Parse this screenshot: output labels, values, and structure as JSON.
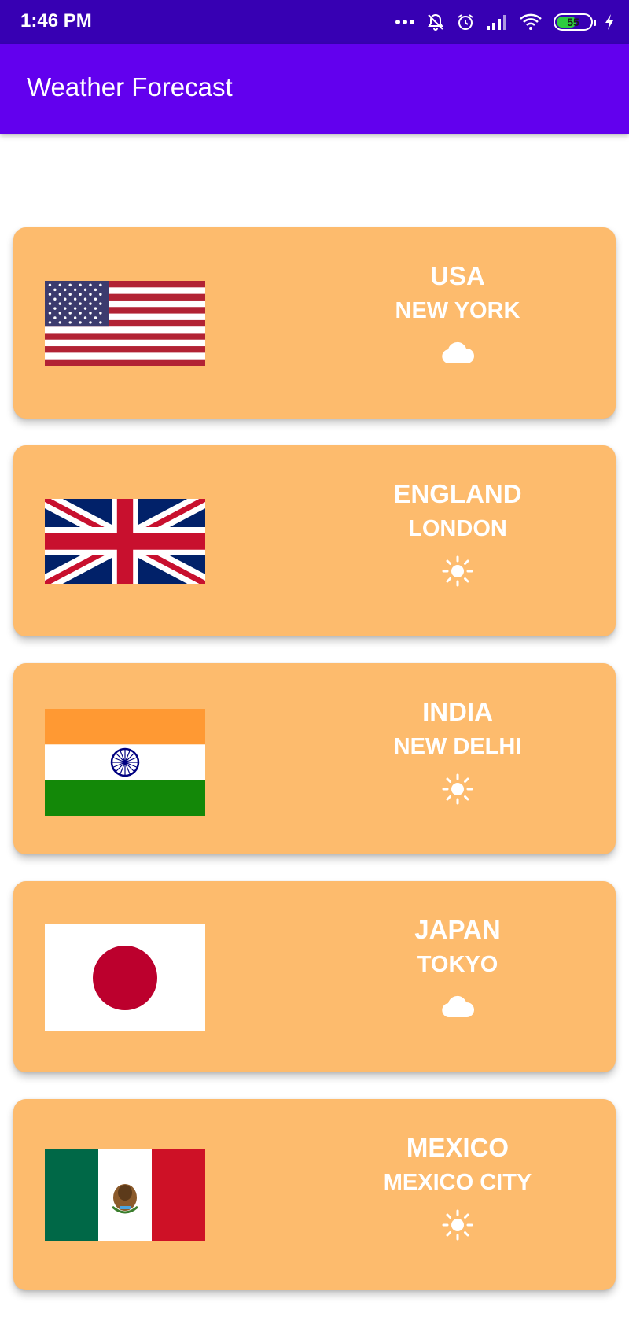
{
  "status_bar": {
    "time": "1:46 PM",
    "battery_level": "55",
    "icons": [
      "more-dots-icon",
      "mute-bell-icon",
      "alarm-icon",
      "signal-icon",
      "wifi-icon",
      "battery-icon",
      "charging-bolt-icon"
    ]
  },
  "app_bar": {
    "title": "Weather Forecast",
    "color": "#6200ee"
  },
  "colors": {
    "status_bar": "#3700b3",
    "card_background": "#fdbb6d"
  },
  "locations": [
    {
      "country": "USA",
      "city": "NEW YORK",
      "weather_icon": "cloud-icon",
      "flag": "usa-flag"
    },
    {
      "country": "ENGLAND",
      "city": "LONDON",
      "weather_icon": "sun-icon",
      "flag": "uk-flag"
    },
    {
      "country": "INDIA",
      "city": "NEW DELHI",
      "weather_icon": "sun-icon",
      "flag": "india-flag"
    },
    {
      "country": "JAPAN",
      "city": "TOKYO",
      "weather_icon": "cloud-icon",
      "flag": "japan-flag"
    },
    {
      "country": "MEXICO",
      "city": "MEXICO CITY",
      "weather_icon": "sun-icon",
      "flag": "mexico-flag"
    }
  ]
}
